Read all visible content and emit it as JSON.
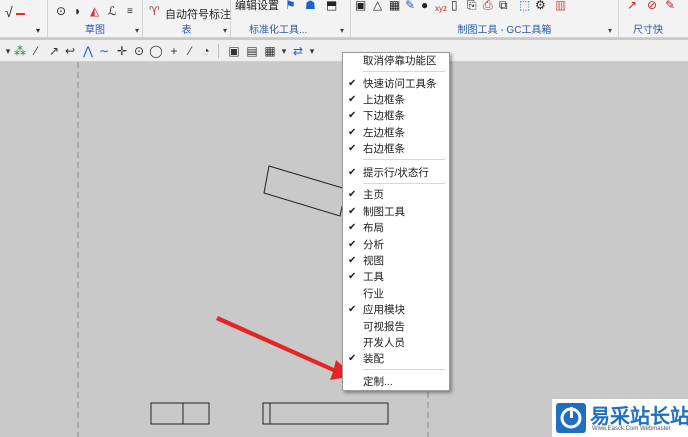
{
  "ribbon": {
    "groups": [
      {
        "label": ""
      },
      {
        "label": "草图"
      },
      {
        "label": "表"
      },
      {
        "label": "标准化工具..."
      },
      {
        "label": "制图工具 - GC工具箱"
      },
      {
        "label": "尺寸快"
      }
    ],
    "buttons": {
      "auto_symbol": "自动符号标注",
      "edit_settings": "编辑设置",
      "xyz": "xyz"
    }
  },
  "context_menu": {
    "items": [
      {
        "label": "取消停靠功能区",
        "checked": false
      },
      {
        "label": "快速访问工具条",
        "checked": true
      },
      {
        "label": "上边框条",
        "checked": true
      },
      {
        "label": "下边框条",
        "checked": true
      },
      {
        "label": "左边框条",
        "checked": true
      },
      {
        "label": "右边框条",
        "checked": true
      },
      {
        "label": "提示行/状态行",
        "checked": true
      },
      {
        "label": "主页",
        "checked": true
      },
      {
        "label": "制图工具",
        "checked": true
      },
      {
        "label": "布局",
        "checked": true
      },
      {
        "label": "分析",
        "checked": true
      },
      {
        "label": "视图",
        "checked": true
      },
      {
        "label": "工具",
        "checked": true
      },
      {
        "label": "行业",
        "checked": false
      },
      {
        "label": "应用模块",
        "checked": true
      },
      {
        "label": "可视报告",
        "checked": false
      },
      {
        "label": "开发人员",
        "checked": false
      },
      {
        "label": "装配",
        "checked": true
      },
      {
        "label": "定制...",
        "checked": false
      }
    ]
  },
  "check_glyph": "✔",
  "colors": {
    "arrow": "#e52525",
    "ribbon_label": "#2a5aa8",
    "logo_blue": "#1f6fc0"
  },
  "watermark": {
    "title": "易采站长站",
    "subtitle": "Www.Easck.Com  Webmaster"
  }
}
